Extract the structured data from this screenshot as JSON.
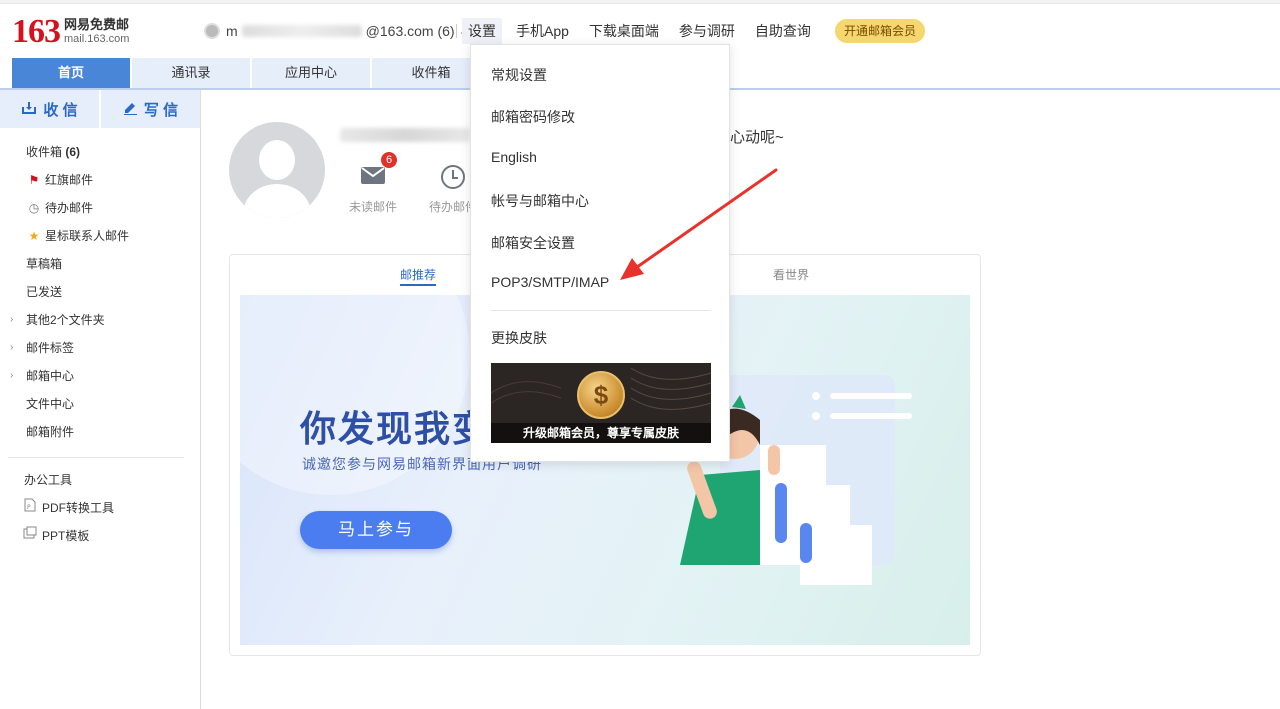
{
  "header": {
    "logo_number": "163",
    "logo_cn": "网易免费邮",
    "logo_en": "mail.163.com",
    "account_prefix": "m",
    "account_suffix": "@163.com (6)",
    "nav": [
      "设置",
      "手机App",
      "下载桌面端",
      "参与调研",
      "自助查询"
    ],
    "vip_button": "开通邮箱会员"
  },
  "tabs": [
    "首页",
    "通讯录",
    "应用中心",
    "收件箱"
  ],
  "sidebar": {
    "receive": "收 信",
    "write": "写 信",
    "folders": [
      {
        "label": "收件箱",
        "count": "(6)"
      },
      {
        "label": "红旗邮件"
      },
      {
        "label": "待办邮件"
      },
      {
        "label": "星标联系人邮件"
      },
      {
        "label": "草稿箱"
      },
      {
        "label": "已发送"
      },
      {
        "label": "其他2个文件夹"
      },
      {
        "label": "邮件标签"
      },
      {
        "label": "邮箱中心"
      },
      {
        "label": "文件中心"
      },
      {
        "label": "邮箱附件"
      }
    ],
    "tools_title": "办公工具",
    "tools": [
      "PDF转换工具",
      "PPT模板"
    ]
  },
  "profile": {
    "greeting": "心动呢~",
    "unread_count": "6",
    "unread_label": "未读邮件",
    "todo_label": "待办邮件"
  },
  "card": {
    "tab_recommend": "邮推荐",
    "tab_world": "看世界",
    "banner_title": "你发现我变",
    "banner_subtitle": "诚邀您参与网易邮箱新界面用户调研",
    "banner_button": "马上参与"
  },
  "settings_menu": {
    "items": [
      "常规设置",
      "邮箱密码修改",
      "English",
      "帐号与邮箱中心",
      "邮箱安全设置",
      "POP3/SMTP/IMAP"
    ],
    "skin": "更换皮肤",
    "skin_promo": "升级邮箱会员，尊享专属皮肤"
  },
  "colors": {
    "brand_red": "#d3121d",
    "tab_active": "#4a86d8",
    "link_blue": "#2a6ac6",
    "annotation_arrow": "#e8322b",
    "vip_gold": "#f5d66f"
  }
}
